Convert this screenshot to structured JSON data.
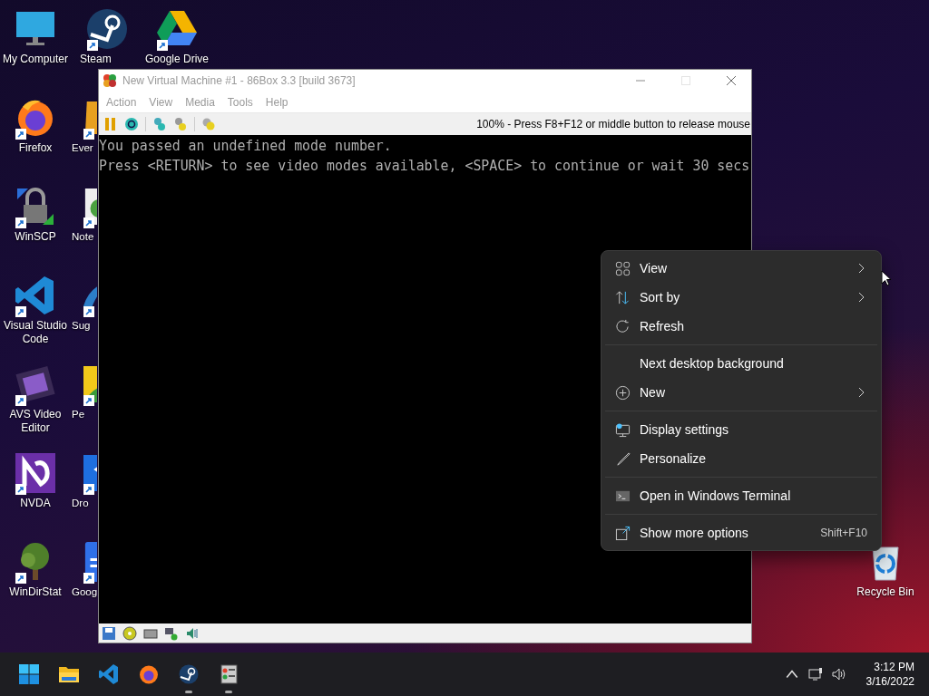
{
  "desktop": {
    "columns": [
      [
        {
          "label": "My Computer",
          "kind": "computer",
          "shortcut": false
        },
        {
          "label": "Firefox",
          "kind": "firefox",
          "shortcut": true
        },
        {
          "label": "WinSCP",
          "kind": "winscp",
          "shortcut": true
        },
        {
          "label": "Visual Studio Code",
          "kind": "vscode",
          "shortcut": true
        },
        {
          "label": "AVS Video Editor",
          "kind": "avs",
          "shortcut": true
        },
        {
          "label": "NVDA",
          "kind": "nvda",
          "shortcut": true
        },
        {
          "label": "WinDirStat",
          "kind": "tree",
          "shortcut": true
        }
      ],
      [
        {
          "label": "Steam",
          "kind": "steam",
          "shortcut": true
        },
        {
          "label": "Ever",
          "kind": "orange",
          "shortcut": true
        },
        {
          "label": "Note",
          "kind": "notepad",
          "shortcut": true
        },
        {
          "label": "Sug",
          "kind": "swoosh",
          "shortcut": true
        },
        {
          "label": "Pe",
          "kind": "yellow",
          "shortcut": true
        },
        {
          "label": "Dro",
          "kind": "bluebox",
          "shortcut": true
        },
        {
          "label": "Goog",
          "kind": "doc",
          "shortcut": true
        }
      ],
      [
        {
          "label": "Google Drive",
          "kind": "drive",
          "shortcut": true
        }
      ]
    ],
    "recycle_bin": {
      "label": "Recycle Bin",
      "kind": "recycle",
      "shortcut": false
    }
  },
  "window": {
    "title": "New Virtual Machine #1 - 86Box 3.3 [build 3673]",
    "menu": [
      "Action",
      "View",
      "Media",
      "Tools",
      "Help"
    ],
    "toolbar_message": "100% - Press F8+F12 or middle button to release mouse",
    "console_lines": [
      "You passed an undefined mode number.",
      "Press <RETURN> to see video modes available, <SPACE> to continue or wait 30 secs"
    ]
  },
  "context_menu": {
    "groups": [
      [
        {
          "label": "View",
          "kind": "grid",
          "submenu": true
        },
        {
          "label": "Sort by",
          "kind": "sort",
          "submenu": true
        },
        {
          "label": "Refresh",
          "kind": "refresh",
          "submenu": false
        }
      ],
      [
        {
          "label": "Next desktop background",
          "kind": "none",
          "submenu": false
        },
        {
          "label": "New",
          "kind": "plus",
          "submenu": true
        }
      ],
      [
        {
          "label": "Display settings",
          "kind": "display",
          "submenu": false
        },
        {
          "label": "Personalize",
          "kind": "brush",
          "submenu": false
        }
      ],
      [
        {
          "label": "Open in Windows Terminal",
          "kind": "terminal",
          "submenu": false
        }
      ],
      [
        {
          "label": "Show more options",
          "kind": "more",
          "submenu": false,
          "shortcut": "Shift+F10"
        }
      ]
    ]
  },
  "taskbar": {
    "apps": [
      {
        "kind": "start",
        "running": false
      },
      {
        "kind": "folder",
        "running": false
      },
      {
        "kind": "vscode",
        "running": false
      },
      {
        "kind": "firefox",
        "running": false
      },
      {
        "kind": "steam",
        "running": true
      },
      {
        "kind": "emulator",
        "running": true
      }
    ],
    "clock": {
      "time": "3:12 PM",
      "date": "3/16/2022"
    }
  }
}
